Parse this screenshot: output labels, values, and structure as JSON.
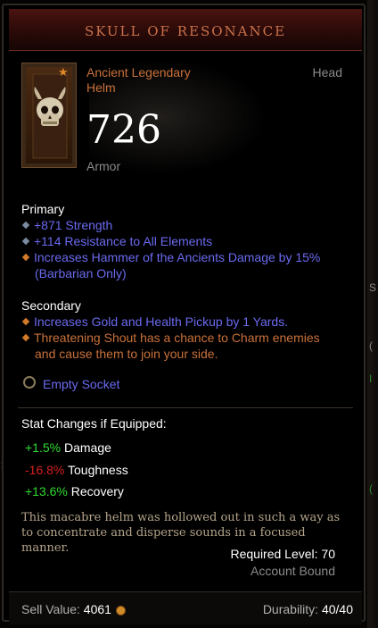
{
  "item": {
    "name": "SKULL OF RESONANCE",
    "rarity": "Ancient Legendary",
    "type": "Helm",
    "slot": "Head",
    "armor_value": "726",
    "armor_label": "Armor"
  },
  "primary": {
    "heading": "Primary",
    "affixes": [
      {
        "text": "+871 Strength",
        "kind": "normal"
      },
      {
        "text": "+114 Resistance to All Elements",
        "kind": "normal"
      },
      {
        "text": "Increases Hammer of the Ancients Damage by 15%",
        "text2": "(Barbarian Only)",
        "kind": "legendary"
      }
    ]
  },
  "secondary": {
    "heading": "Secondary",
    "affixes": [
      {
        "text": "Increases Gold and Health Pickup by 1 Yards.",
        "kind": "legendary"
      },
      {
        "text": "Threatening Shout has a chance to Charm enemies",
        "text2": "and cause them to join your side.",
        "kind": "legendary-orange"
      }
    ]
  },
  "socket": {
    "label": "Empty Socket"
  },
  "stat_changes": {
    "heading": "Stat Changes if Equipped:",
    "rows": [
      {
        "delta": "+1.5%",
        "name": "Damage",
        "direction": "up"
      },
      {
        "delta": "-16.8%",
        "name": "Toughness",
        "direction": "down"
      },
      {
        "delta": "+13.6%",
        "name": "Recovery",
        "direction": "up"
      }
    ]
  },
  "flavor_text": "This macabre helm was hollowed out in such a way as to concentrate and disperse sounds in a focused manner.",
  "required_level": "Required Level: 70",
  "account_bound": "Account Bound",
  "footer": {
    "sell_label": "Sell Value:",
    "sell_value": "4061",
    "durability_label": "Durability:",
    "durability_value": "40/40"
  },
  "colors": {
    "legendary_orange": "#c9713a",
    "magic_blue": "#6a6af0",
    "stat_up": "#2fdc2f",
    "stat_down": "#d62020"
  }
}
